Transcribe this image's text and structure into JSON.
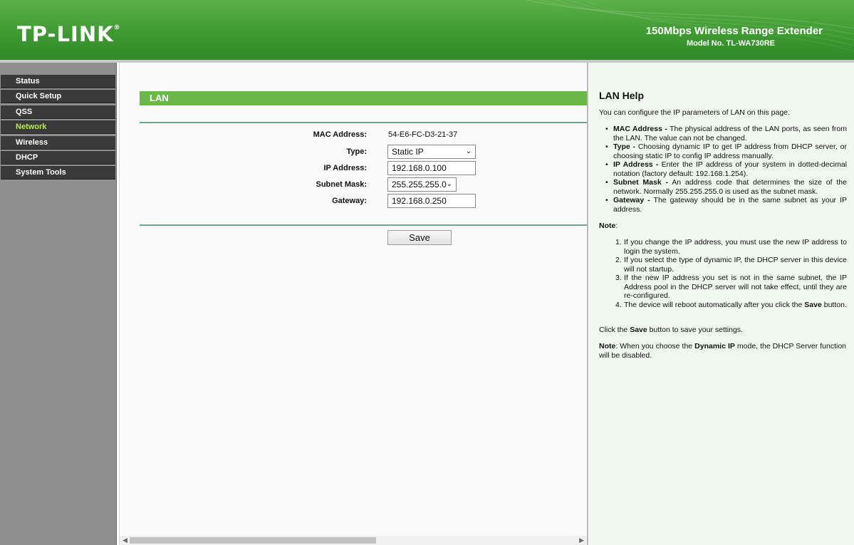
{
  "header": {
    "logo": "TP-LINK",
    "logo_mark": "®",
    "product_title": "150Mbps Wireless Range Extender",
    "model_no": "Model No. TL-WA730RE"
  },
  "sidebar": {
    "items": [
      {
        "label": "Status",
        "active": false
      },
      {
        "label": "Quick Setup",
        "active": false
      },
      {
        "label": "QSS",
        "active": false
      },
      {
        "label": "Network",
        "active": true
      },
      {
        "label": "Wireless",
        "active": false
      },
      {
        "label": "DHCP",
        "active": false
      },
      {
        "label": "System Tools",
        "active": false
      }
    ]
  },
  "lan": {
    "section_title": "LAN",
    "mac_label": "MAC Address:",
    "mac_value": "54-E6-FC-D3-21-37",
    "type_label": "Type:",
    "type_value": "Static IP",
    "ip_label": "IP Address:",
    "ip_value": "192.168.0.100",
    "subnet_label": "Subnet Mask:",
    "subnet_value": "255.255.255.0",
    "gateway_label": "Gateway:",
    "gateway_value": "192.168.0.250",
    "save_label": "Save"
  },
  "help": {
    "title": "LAN Help",
    "intro": "You can configure the IP parameters of LAN on this page.",
    "items": [
      {
        "term": "MAC Address -",
        "text": " The physical address of the LAN ports, as seen from the LAN. The value can not be changed."
      },
      {
        "term": "Type -",
        "text": " Choosing dynamic IP to get IP address from DHCP server, or choosing static IP to config IP address manually."
      },
      {
        "term": "IP Address -",
        "text": " Enter the IP address of your system in dotted-decimal notation (factory default: 192.168.1.254)."
      },
      {
        "term": "Subnet Mask -",
        "text": " An address code that determines the size of the network. Normally 255.255.255.0 is used as the subnet mask."
      },
      {
        "term": "Gateway -",
        "text": " The gateway should be in the same subnet as your IP address."
      }
    ],
    "note_label": "Note",
    "note_colon": ":",
    "notes": [
      {
        "num": "1.",
        "text": "If you change the IP address, you must use the new IP address to login the system."
      },
      {
        "num": "2.",
        "text": "If you select the type of dynamic IP, the DHCP server in this device will not startup."
      },
      {
        "num": "3.",
        "text": "If the new IP address you set is not in the same subnet, the IP Address pool in the DHCP server will not take effect, until they are re-configured."
      },
      {
        "num": "4.",
        "pre": "The device will reboot automatically after you click the ",
        "bold": "Save",
        "post": " button."
      }
    ],
    "click_pre": "Click the ",
    "click_bold": "Save",
    "click_post": " button to save your settings.",
    "note2_label": "Note",
    "note2_pre": ": When you choose the ",
    "note2_bold": "Dynamic IP",
    "note2_post": " mode, the DHCP Server function will be disabled."
  },
  "colors": {
    "header_green": "#3f9a32",
    "section_bar_green": "#6ab848",
    "active_menu": "#b6f046",
    "menu_bg": "#3a3a3a",
    "help_bg": "#f1f8ef"
  }
}
